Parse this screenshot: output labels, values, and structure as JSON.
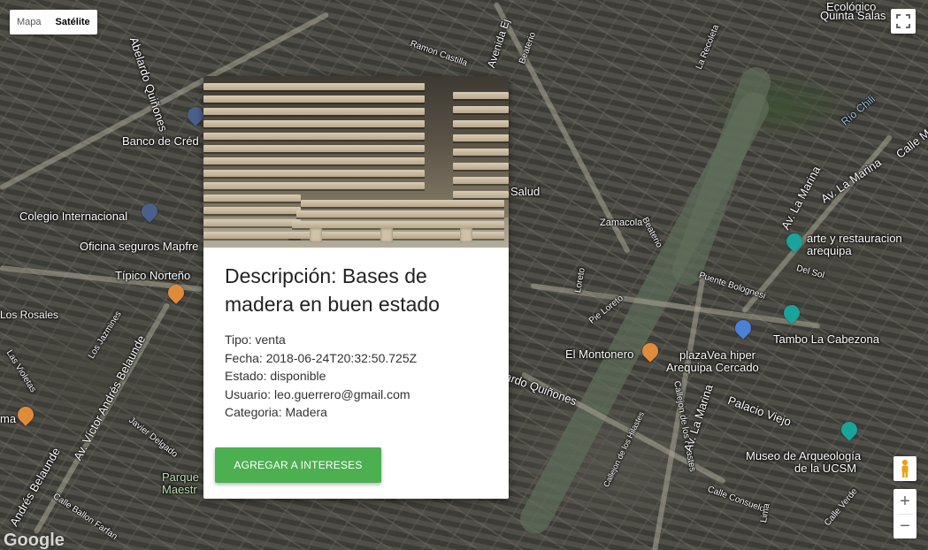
{
  "map": {
    "type_buttons": [
      "Mapa",
      "Satélite"
    ],
    "active_type": "Satélite",
    "zoom_in": "+",
    "zoom_out": "−",
    "brand": "Google",
    "labels": {
      "abelardo": "Abelardo Quiñones",
      "banco": "Banco de Créd",
      "colegio": "Colegio Internacional",
      "oficina": "Oficina seguros Mapfre",
      "tipico": "Típico Norteño",
      "rosales": "Los Rosales",
      "jazmines": "Los Jazmines",
      "victor": "Av. Víctor Andrés Belaunde",
      "violetas": "Las Violetas",
      "delgado": "Javier Delgado",
      "andres": "Andrés Belaunde",
      "ballon": "Calle Ballon Farfan",
      "parque": "Parque Maestr",
      "ma": "ma",
      "delgado2": "Delgado",
      "ramon": "Ramon Castilla",
      "pie": "Pie Lo",
      "avenida": "Avenida Ej",
      "beaterio": "Beaterio",
      "recoleta": "La Recoleta",
      "ecologico": "Ecológico",
      "quinta": "Quinta Salas",
      "rio": "Río Chili",
      "calle_me": "Calle Me",
      "av_lamarina1": "Av. La Marina",
      "av_lamarina2": "Av. La Marina",
      "salud": "Salud",
      "zamacola": "Zamacola",
      "beaterio2": "Beaterio",
      "arte": "arte y restauracion",
      "arequipa": "arequipa",
      "delsol": "Del Sol",
      "bolognesi": "Puente Bolognesi",
      "loreto": "Loreto",
      "pie_loreto": "Pie Loreto",
      "plaza": "plazaVea hiper",
      "plaza2": "Arequipa Cercado",
      "tambo": "Tambo La Cabezona",
      "montonero": "El Montonero",
      "ardo": "ardo Quiñones",
      "hilastes": "Callejon de los Hilastes",
      "lamarina3": "Av. La Marina",
      "palacio": "Palacio Viejo",
      "museo": "Museo de Arqueología",
      "ucsm": "de la UCSM",
      "consuelo": "Calle Consuelo",
      "callejon": "Callejon de los Hilastes",
      "lima": "Lima",
      "verde": "Calle Verde"
    }
  },
  "card": {
    "title": "Descripción: Bases de madera en buen estado",
    "tipo": "Tipo: venta",
    "fecha": "Fecha: 2018-06-24T20:32:50.725Z",
    "estado": "Estado: disponible",
    "usuario": "Usuario: leo.guerrero@gmail.com",
    "categoria": "Categoria: Madera",
    "button": "AGREGAR A INTERESES"
  },
  "colors": {
    "button": "#4caf50",
    "card_bg": "#ffffff"
  }
}
